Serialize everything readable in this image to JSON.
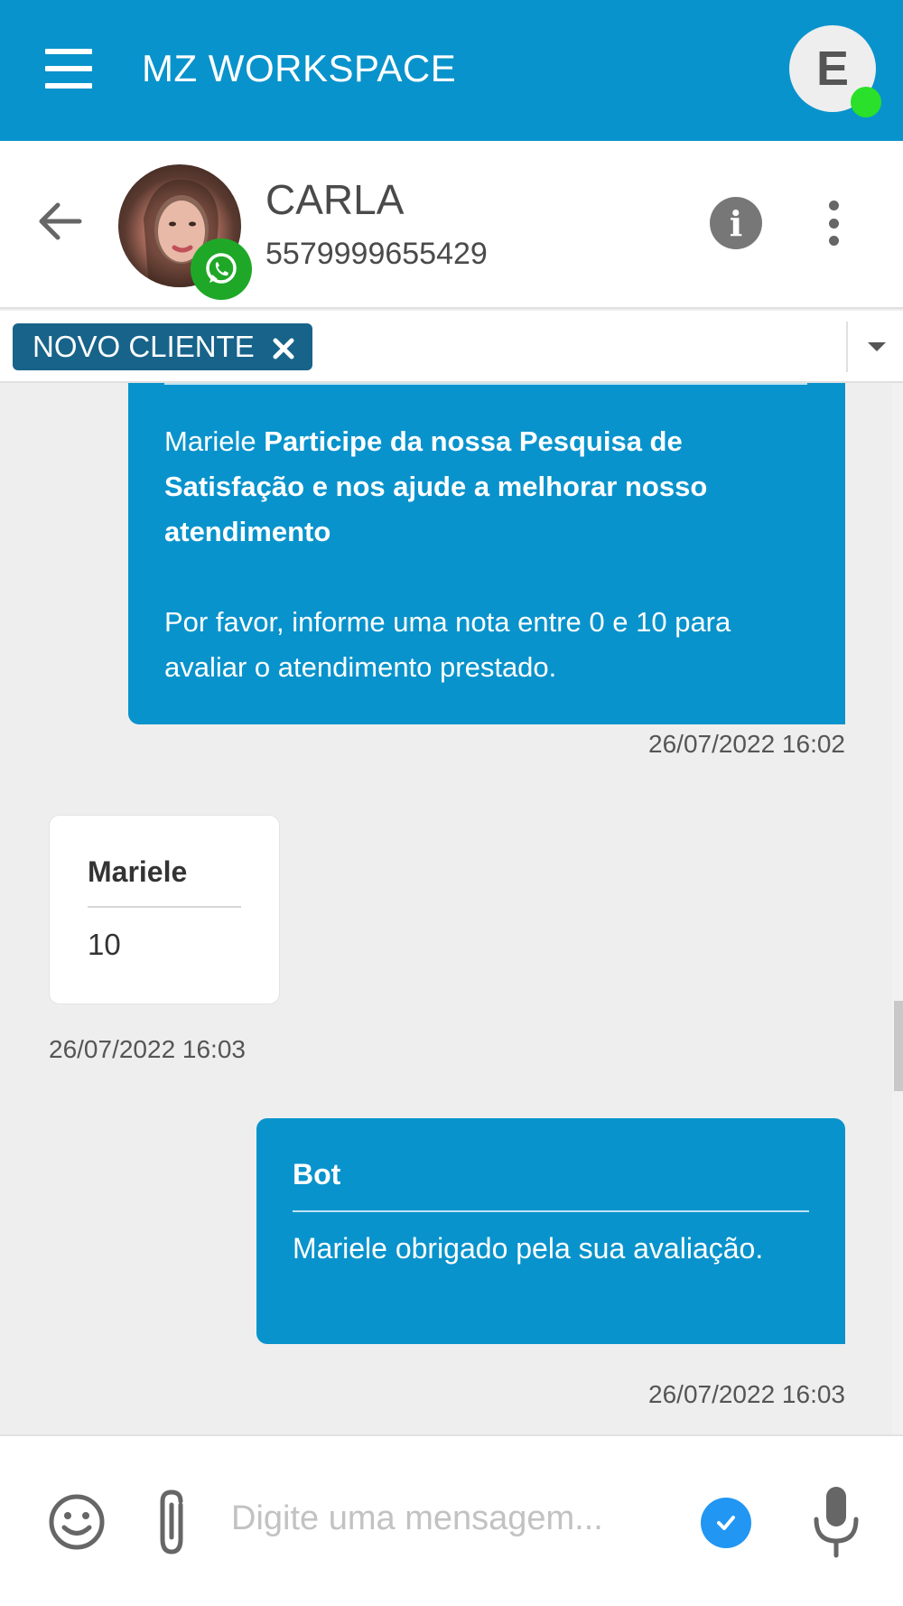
{
  "appbar": {
    "title": "MZ WORKSPACE",
    "user_initial": "E",
    "status_color": "#2ae02a",
    "color": "#0993cc"
  },
  "contact": {
    "name": "CARLA",
    "phone": "5579999655429",
    "channel_icon": "whatsapp-icon"
  },
  "tags": [
    {
      "label": "NOVO CLIENTE",
      "color": "#17638a"
    }
  ],
  "messages": [
    {
      "direction": "outgoing",
      "text_prefix": "Mariele ",
      "text_bold": "Participe da nossa Pesquisa de Satisfação e nos ajude a melhorar nosso atendimento",
      "text_body": "Por favor, informe uma nota entre 0 e 10 para avaliar o atendimento prestado.",
      "timestamp": "26/07/2022 16:02"
    },
    {
      "direction": "incoming",
      "sender": "Mariele",
      "text": "10",
      "timestamp": "26/07/2022 16:03"
    },
    {
      "direction": "outgoing",
      "sender": "Bot",
      "text": "Mariele obrigado pela sua avaliação.",
      "timestamp": "26/07/2022 16:03"
    }
  ],
  "composer": {
    "placeholder": "Digite uma mensagem...",
    "icons": [
      "emoji-icon",
      "paperclip-icon",
      "check-icon",
      "microphone-icon"
    ]
  }
}
